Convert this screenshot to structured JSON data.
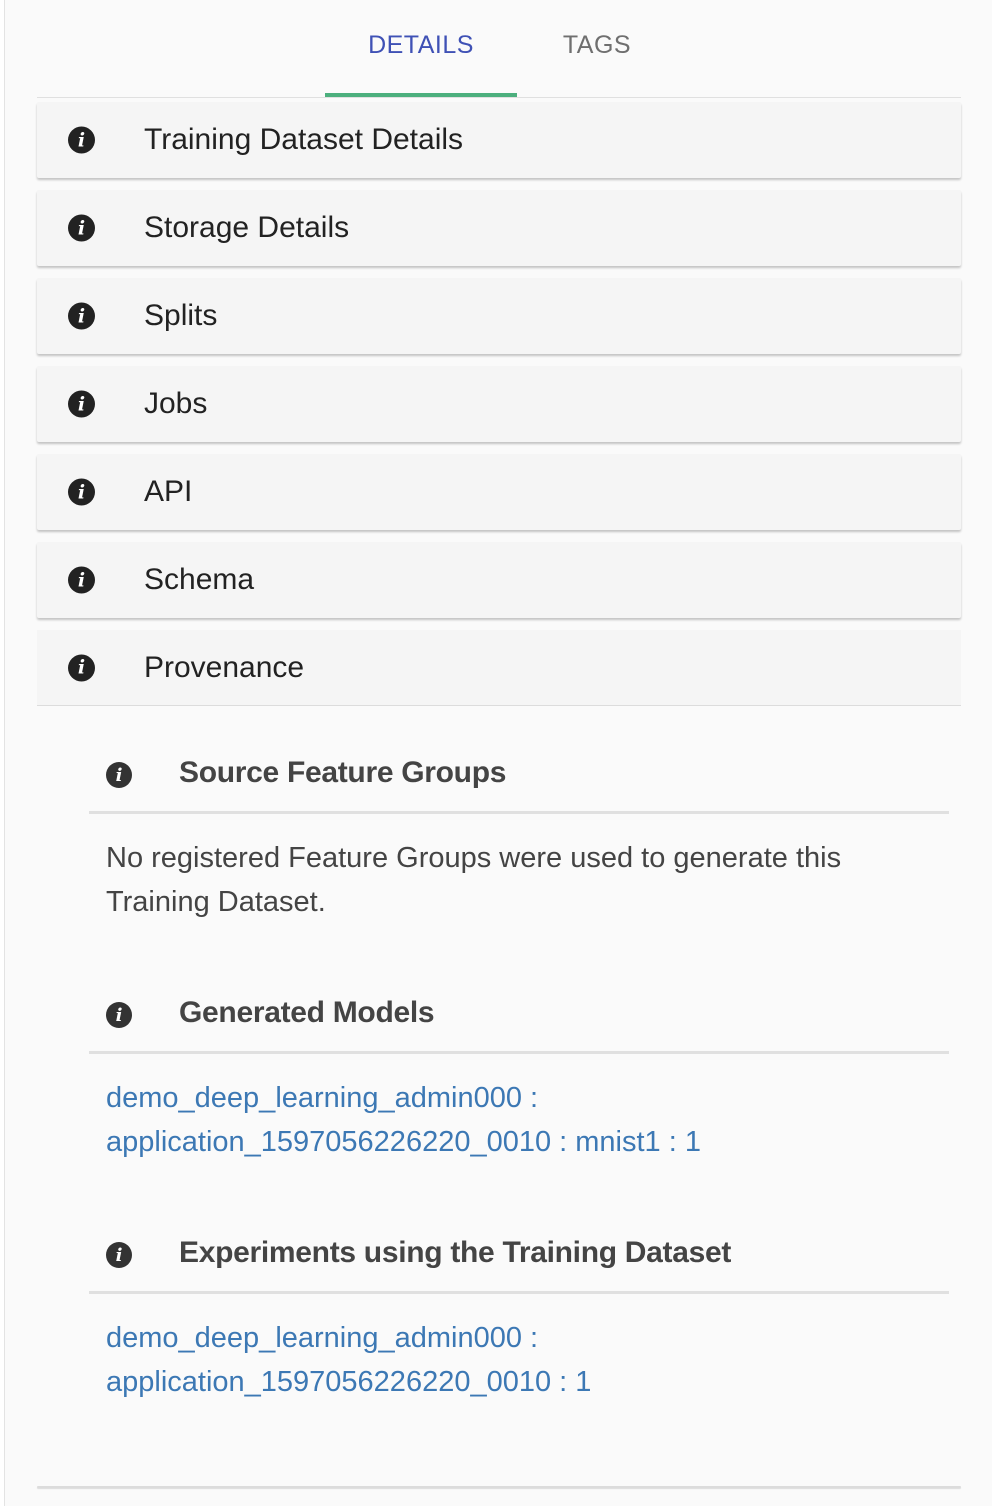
{
  "tabs": [
    {
      "label": "DETAILS",
      "active": true
    },
    {
      "label": "TAGS",
      "active": false
    }
  ],
  "accordion": [
    {
      "label": "Training Dataset Details",
      "icon": "info-icon"
    },
    {
      "label": "Storage Details",
      "icon": "info-icon"
    },
    {
      "label": "Splits",
      "icon": "info-icon"
    },
    {
      "label": "Jobs",
      "icon": "info-icon"
    },
    {
      "label": "API",
      "icon": "info-icon"
    },
    {
      "label": "Schema",
      "icon": "info-icon"
    },
    {
      "label": "Provenance",
      "icon": "info-icon",
      "expanded": true
    }
  ],
  "provenance": {
    "source_feature_groups": {
      "title": "Source Feature Groups",
      "text": "No registered Feature Groups were used to generate this Training Dataset."
    },
    "generated_models": {
      "title": "Generated Models",
      "link_line1": "demo_deep_learning_admin000 :",
      "link_line2": "application_1597056226220_0010 : mnist1 : 1"
    },
    "experiments": {
      "title": "Experiments using the Training Dataset",
      "link_line1": "demo_deep_learning_admin000 :",
      "link_line2": "application_1597056226220_0010 : 1"
    }
  },
  "colors": {
    "active_tab": "#3f51b5",
    "tab_indicator": "#4caf7d",
    "link": "#3c78b4"
  }
}
